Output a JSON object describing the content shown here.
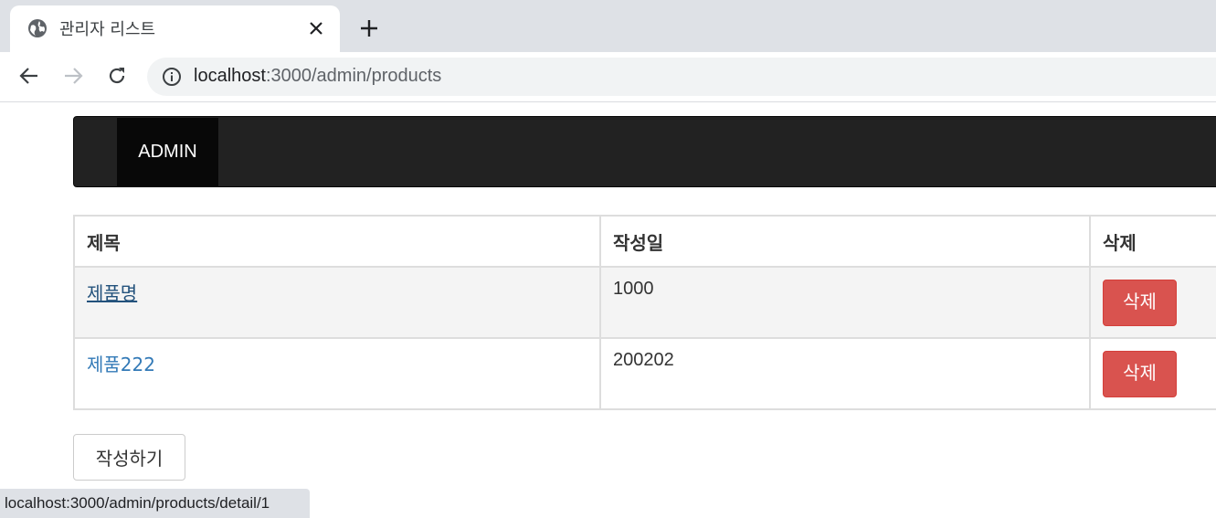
{
  "browser": {
    "tab_title": "관리자 리스트",
    "url_host": "localhost",
    "url_path": ":3000/admin/products",
    "status_url": "localhost:3000/admin/products/detail/1",
    "icons": {
      "favicon": "globe-icon",
      "close": "close-icon",
      "new_tab": "plus-icon",
      "back": "arrow-left-icon",
      "forward": "arrow-right-icon",
      "reload": "reload-icon",
      "site_info": "info-icon"
    }
  },
  "navbar": {
    "brand": "ADMIN",
    "colors": {
      "background": "#222222",
      "brand_background": "#080808",
      "text": "#ffffff"
    }
  },
  "table": {
    "headers": [
      "제목",
      "작성일",
      "삭제"
    ],
    "rows": [
      {
        "title": "제품명",
        "date": "1000",
        "delete_label": "삭제",
        "hovered": true
      },
      {
        "title": "제품222",
        "date": "200202",
        "delete_label": "삭제",
        "hovered": false
      }
    ]
  },
  "actions": {
    "write_label": "작성하기"
  },
  "colors": {
    "link": "#337ab7",
    "link_hover": "#23527c",
    "danger": "#d9534f",
    "stripe": "#f4f4f4"
  }
}
